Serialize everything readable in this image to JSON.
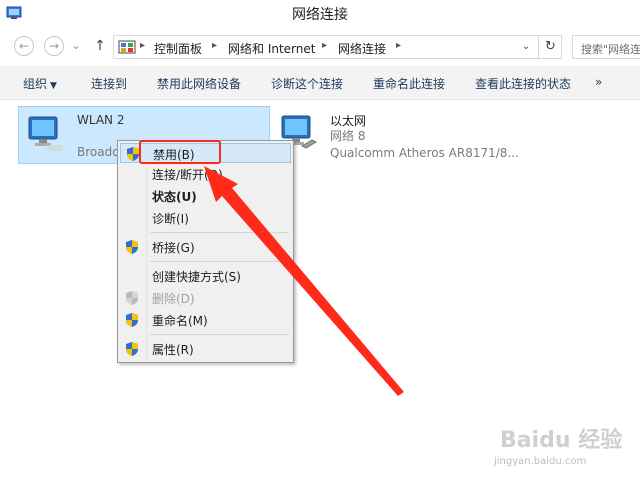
{
  "window": {
    "title": "网络连接"
  },
  "nav": {
    "breadcrumbs": [
      "控制面板",
      "网络和 Internet",
      "网络连接"
    ],
    "search_placeholder": "搜索\"网络连"
  },
  "commands": {
    "organize": "组织",
    "connect_to": "连接到",
    "disable_device": "禁用此网络设备",
    "diagnose": "诊断这个连接",
    "rename": "重命名此连接",
    "view_status": "查看此连接的状态",
    "more": "»"
  },
  "connections": [
    {
      "name": "WLAN 2",
      "status": "",
      "device": "Broado",
      "selected": true
    },
    {
      "name": "以太网",
      "status": "网络 8",
      "device": "Qualcomm Atheros AR8171/8...",
      "selected": false
    }
  ],
  "context_menu": {
    "items": [
      {
        "label": "禁用(B)",
        "icon": "uac-shield-icon",
        "state": "hover"
      },
      {
        "label": "连接/断开(O)",
        "icon": "",
        "state": "normal"
      },
      {
        "label": "状态(U)",
        "icon": "",
        "state": "bold"
      },
      {
        "label": "诊断(I)",
        "icon": "",
        "state": "normal"
      },
      {
        "label": "桥接(G)",
        "icon": "uac-shield-icon",
        "state": "normal"
      },
      {
        "label": "创建快捷方式(S)",
        "icon": "",
        "state": "normal"
      },
      {
        "label": "删除(D)",
        "icon": "uac-shield-icon",
        "state": "disabled"
      },
      {
        "label": "重命名(M)",
        "icon": "uac-shield-icon",
        "state": "normal"
      },
      {
        "label": "属性(R)",
        "icon": "uac-shield-icon",
        "state": "normal"
      }
    ]
  },
  "annotation": {
    "color": "#ff2a1a"
  },
  "watermark": {
    "text": "Baidu 经验",
    "url": "jingyan.baidu.com"
  },
  "colors": {
    "selection": "#cce8ff",
    "menu_hover": "#d6e9f8",
    "accent": "#1e3a5f"
  }
}
